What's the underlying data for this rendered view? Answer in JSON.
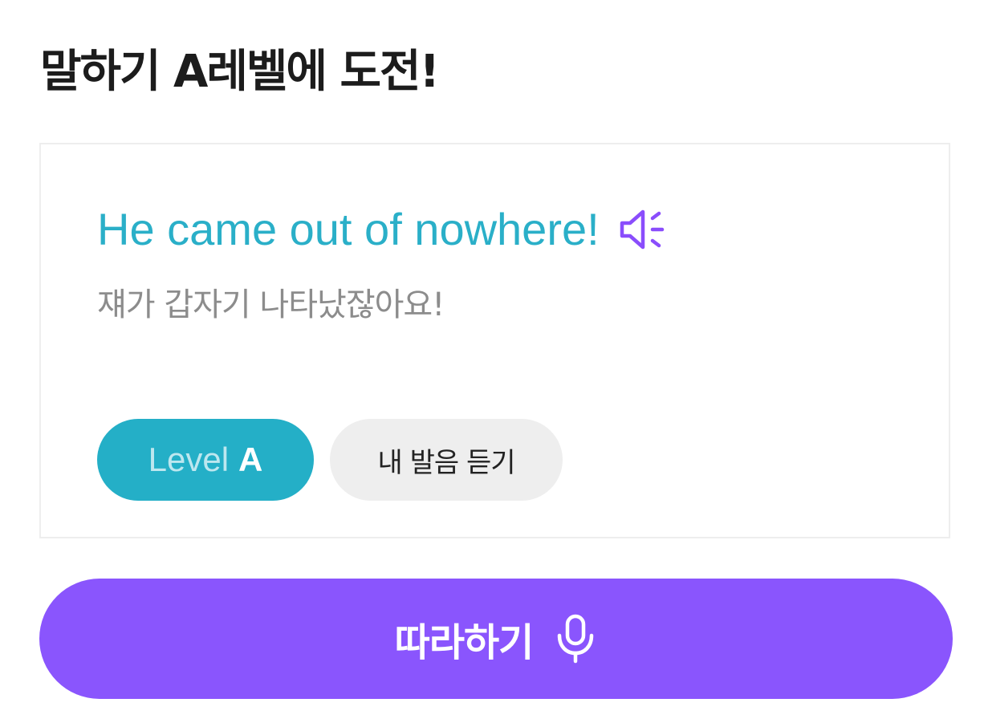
{
  "header": {
    "title": "말하기 A레벨에 도전!"
  },
  "card": {
    "english_sentence": "He came out of nowhere!",
    "speaker_icon": "speaker-icon",
    "translation": "쟤가 갑자기 나타났잖아요!",
    "level_prefix": "Level",
    "level_value": "A",
    "listen_label": "내 발음 듣기"
  },
  "action": {
    "follow_label": "따라하기",
    "mic_icon": "microphone-icon"
  },
  "colors": {
    "accent_teal": "#24afc7",
    "accent_purple": "#8a55fd",
    "speaker_purple": "#8a4dfc",
    "pill_gray": "#eeeeee"
  }
}
